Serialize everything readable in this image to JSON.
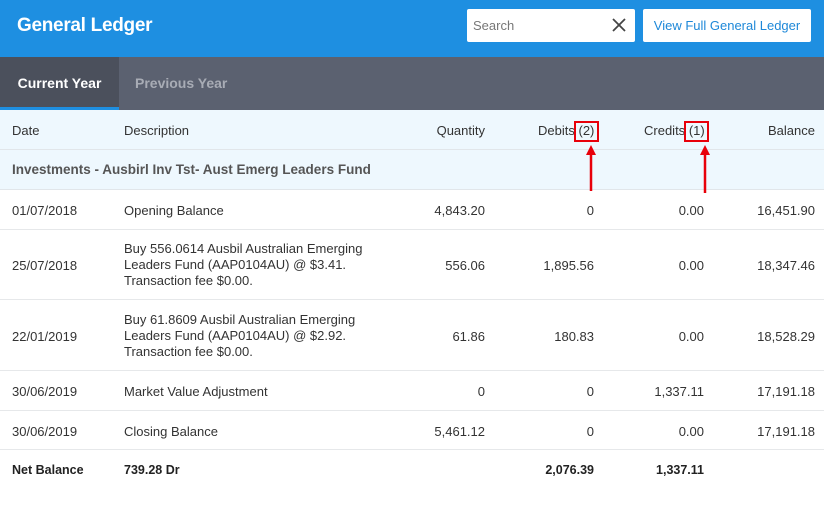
{
  "header": {
    "title": "General Ledger",
    "search_placeholder": "Search",
    "search_value": "",
    "view_full_label": "View Full General Ledger"
  },
  "tabs": [
    {
      "label": "Current Year",
      "active": true
    },
    {
      "label": "Previous Year",
      "active": false
    }
  ],
  "columns": {
    "date": "Date",
    "description": "Description",
    "quantity": "Quantity",
    "debits": "Debits",
    "debits_count": "(2)",
    "credits": "Credits",
    "credits_count": "(1)",
    "balance": "Balance"
  },
  "group": {
    "name": "Investments - Ausbirl Inv Tst- Aust Emerg Leaders Fund"
  },
  "rows": [
    {
      "date": "01/07/2018",
      "description": "Opening Balance",
      "quantity": "4,843.20",
      "debits": "0",
      "credits": "0.00",
      "balance": "16,451.90"
    },
    {
      "date": "25/07/2018",
      "description": "Buy 556.0614 Ausbil Australian Emerging Leaders Fund (AAP0104AU) @ $3.41. Transaction fee $0.00.",
      "quantity": "556.06",
      "debits": "1,895.56",
      "credits": "0.00",
      "balance": "18,347.46"
    },
    {
      "date": "22/01/2019",
      "description": "Buy 61.8609 Ausbil Australian Emerging Leaders Fund (AAP0104AU) @ $2.92. Transaction fee $0.00.",
      "quantity": "61.86",
      "debits": "180.83",
      "credits": "0.00",
      "balance": "18,528.29"
    },
    {
      "date": "30/06/2019",
      "description": "Market Value Adjustment",
      "quantity": "0",
      "debits": "0",
      "credits": "1,337.11",
      "balance": "17,191.18"
    },
    {
      "date": "30/06/2019",
      "description": "Closing Balance",
      "quantity": "5,461.12",
      "debits": "0",
      "credits": "0.00",
      "balance": "17,191.18"
    }
  ],
  "net_balance": {
    "label": "Net Balance",
    "value": "739.28 Dr",
    "debits": "2,076.39",
    "credits": "1,337.11"
  },
  "colors": {
    "header_blue": "#1e8fe1",
    "tab_bar": "#5b6170",
    "highlight_red": "#e8000a",
    "table_header_bg": "#eef8fe"
  },
  "icons": {
    "clear": "close-icon",
    "annotation": "red-arrow-up"
  }
}
